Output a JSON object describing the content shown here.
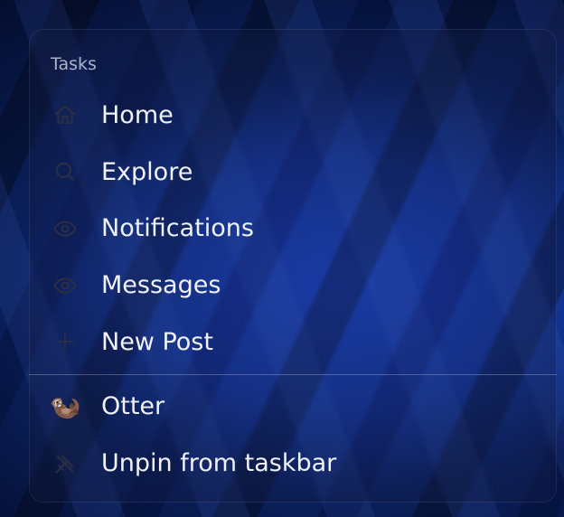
{
  "menu": {
    "section_title": "Tasks",
    "tasks": [
      {
        "label": "Home"
      },
      {
        "label": "Explore"
      },
      {
        "label": "Notifications"
      },
      {
        "label": "Messages"
      },
      {
        "label": "New Post"
      }
    ],
    "app": {
      "name": "Otter",
      "icon": "🦦"
    },
    "unpin_label": "Unpin from taskbar"
  }
}
